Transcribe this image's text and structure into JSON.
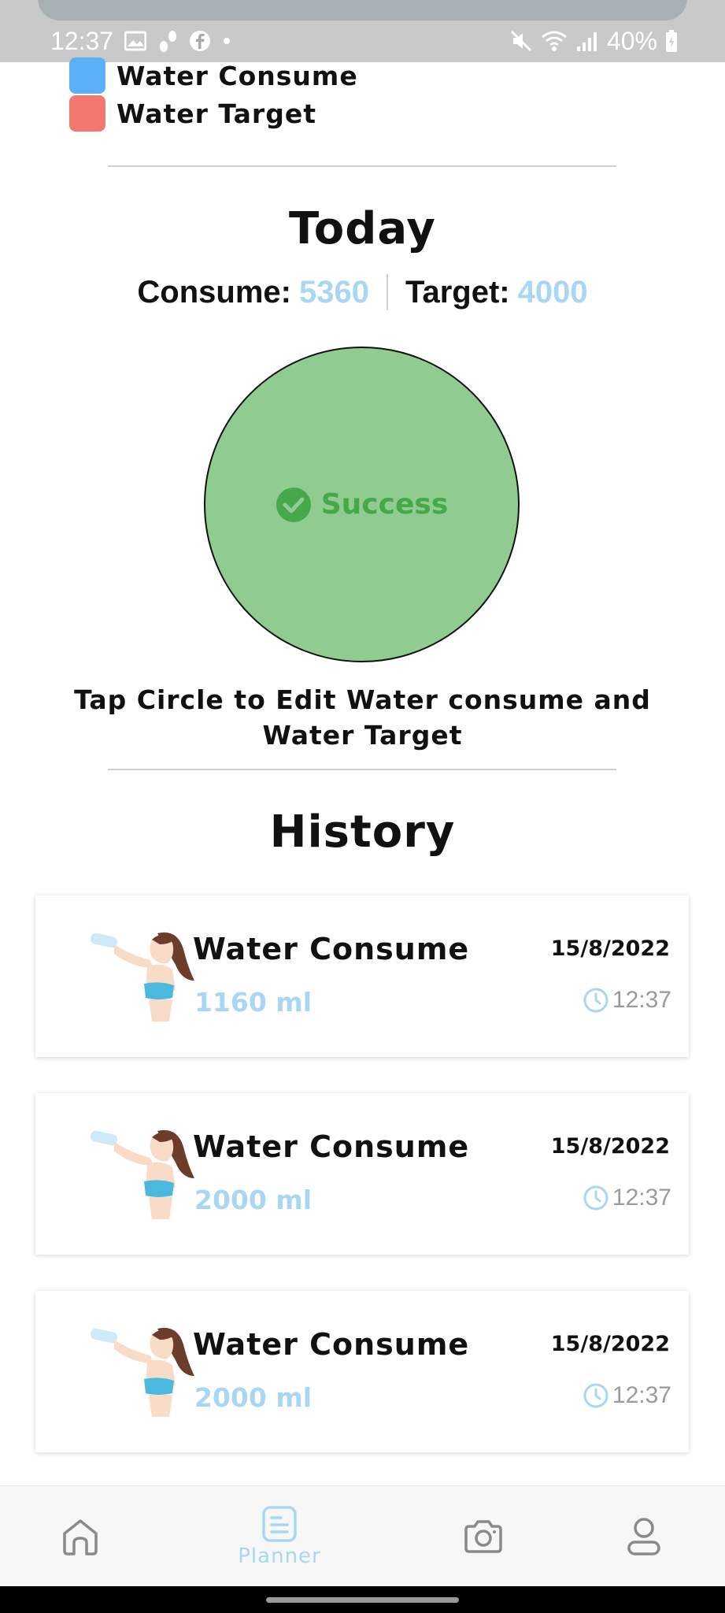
{
  "status_bar": {
    "time": "12:37",
    "battery": "40%",
    "icons": [
      "image-icon",
      "fitness-icon",
      "facebook-icon",
      "dot-icon",
      "mute-icon",
      "wifi-icon",
      "signal-icon",
      "battery-icon"
    ]
  },
  "legend": {
    "items": [
      {
        "label": "Water Consume",
        "color": "#5cb0f5"
      },
      {
        "label": "Water Target",
        "color": "#f2776e"
      }
    ]
  },
  "today": {
    "title": "Today",
    "consume_label": "Consume:",
    "consume_value": "5360",
    "target_label": "Target:",
    "target_value": "4000",
    "status": "Success",
    "circle_color": "#90cc8f",
    "instruction": "Tap Circle to Edit Water consume and Water Target"
  },
  "history": {
    "title": "History",
    "items": [
      {
        "title": "Water Consume",
        "amount": "1160 ml",
        "date": "15/8/2022",
        "time": "12:37"
      },
      {
        "title": "Water Consume",
        "amount": "2000 ml",
        "date": "15/8/2022",
        "time": "12:37"
      },
      {
        "title": "Water Consume",
        "amount": "2000 ml",
        "date": "15/8/2022",
        "time": "12:37"
      }
    ]
  },
  "nav": {
    "items": [
      {
        "icon": "home-icon",
        "label": ""
      },
      {
        "icon": "planner-icon",
        "label": "Planner",
        "active": true
      },
      {
        "icon": "camera-icon",
        "label": ""
      },
      {
        "icon": "profile-icon",
        "label": ""
      }
    ],
    "active_color": "#a9d7f3"
  }
}
